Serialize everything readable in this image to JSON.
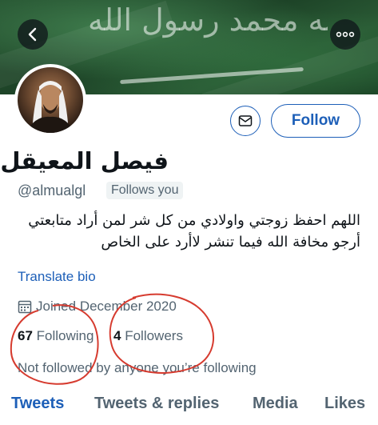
{
  "header": {
    "back_icon": "chevron-left-icon",
    "more_icon": "more-horizontal-icon",
    "banner_text": "لا إله إلا الله محمد رسول الله"
  },
  "profile": {
    "display_name": "فيصل المعيقل",
    "handle": "@almualgl",
    "follows_you_badge": "Follows you",
    "bio": "اللهم احفظ زوجتي واولادي من كل شر لمن أراد متابعتي أرجو مخافة الله فيما تنشر لاأرد على الخاص",
    "translate_label": "Translate bio",
    "joined_label": "Joined December 2020",
    "following_count": "67",
    "following_label": "Following",
    "followers_count": "4",
    "followers_label": "Followers",
    "not_followed_text": "Not followed by anyone you’re following"
  },
  "actions": {
    "message_icon": "mail-icon",
    "follow_label": "Follow"
  },
  "tabs": [
    {
      "label": "Tweets",
      "active": true
    },
    {
      "label": "Tweets & replies",
      "active": false
    },
    {
      "label": "Media",
      "active": false
    },
    {
      "label": "Likes",
      "active": false
    }
  ],
  "colors": {
    "accent": "#1d5fb8",
    "secondary_text": "#536471",
    "annotation": "#d63b2f",
    "banner": "#24502f"
  }
}
